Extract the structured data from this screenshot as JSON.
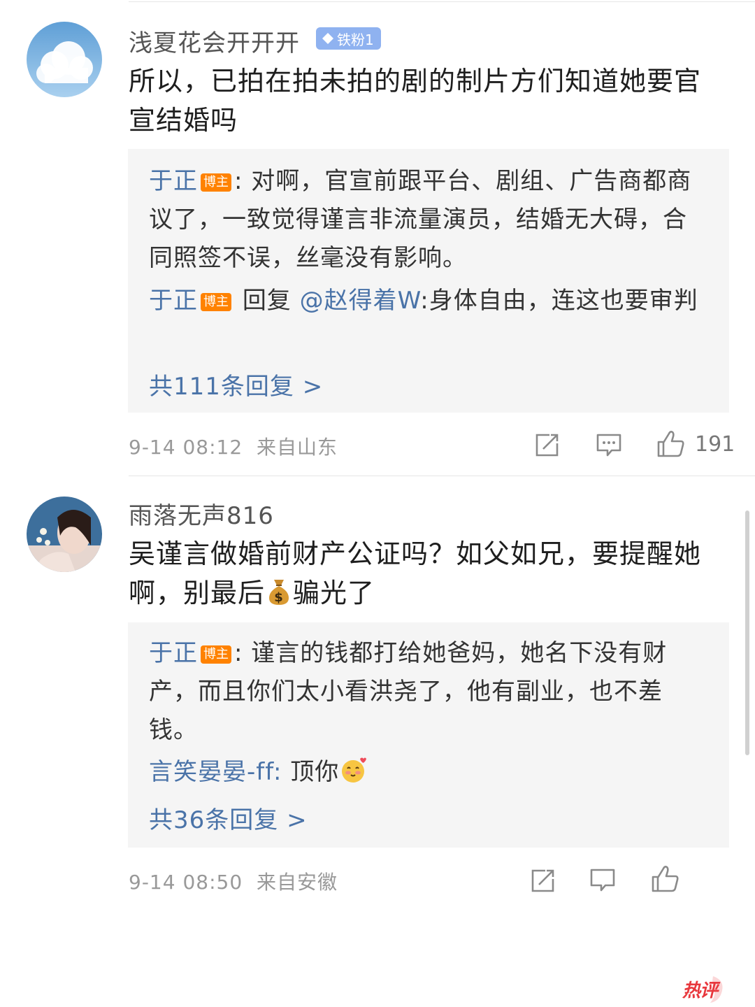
{
  "comments": [
    {
      "username": "浅夏花会开开开",
      "fan_badge": "铁粉1",
      "body": "所以，已拍在拍未拍的剧的制片方们知道她要官宣结婚吗",
      "replies": [
        {
          "author": "于正",
          "badge": "博主",
          "sep": ":",
          "text": "对啊，官宣前跟平台、剧组、广告商都商议了，一致觉得谨言非流量演员，结婚无大碍，合同照签不误，丝毫没有影响。"
        },
        {
          "author": "于正",
          "badge": "博主",
          "reply_word": "回复",
          "mention": "@赵得着W",
          "text": ":身体自由，连这也要审判"
        }
      ],
      "more_replies": "共111条回复 >",
      "time": "9-14 08:12",
      "location": "来自山东",
      "likes": "191"
    },
    {
      "username": "雨落无声816",
      "hot_tag": "热评",
      "body_a": "吴谨言做婚前财产公证吗？如父如兄，要提醒她啊，别最后",
      "body_emoji": "money-bag-emoji",
      "body_b": "骗光了",
      "replies": [
        {
          "author": "于正",
          "badge": "博主",
          "sep": ":",
          "text": "谨言的钱都打给她爸妈，她名下没有财产，而且你们太小看洪尧了，他有副业，也不差钱。"
        },
        {
          "author": "言笑晏晏-ff",
          "sep": ":",
          "text": "顶你"
        }
      ],
      "more_replies": "共36条回复 >",
      "time": "9-14 08:50",
      "location": "来自安徽"
    }
  ],
  "colors": {
    "link": "#4a73a8",
    "blogger_badge": "#ff8200",
    "fan_badge": "#8fb2f0",
    "hot": "#e8383d"
  }
}
